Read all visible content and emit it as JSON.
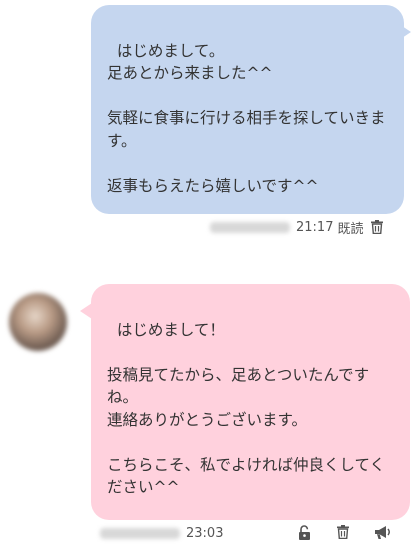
{
  "messages": [
    {
      "direction": "sent",
      "text": "はじめまして。\n足あとから来ました^^\n\n気軽に食事に行ける相手を探していきます。\n\n返事もらえたら嬉しいです^^",
      "time": "21:17",
      "status": "既読",
      "icons": [
        "trash-icon"
      ]
    },
    {
      "direction": "received",
      "text": "はじめまして！\n\n投稿見てたから、足あとついたんですね。\n連絡ありがとうございます。\n\nこちらこそ、私でよければ仲良くしてください^^",
      "time": "23:03",
      "icons": [
        "unlock-icon",
        "trash-icon",
        "megaphone-icon"
      ]
    }
  ],
  "colors": {
    "sent_bubble": "#c5d6ef",
    "received_bubble": "#ffd1dd"
  }
}
